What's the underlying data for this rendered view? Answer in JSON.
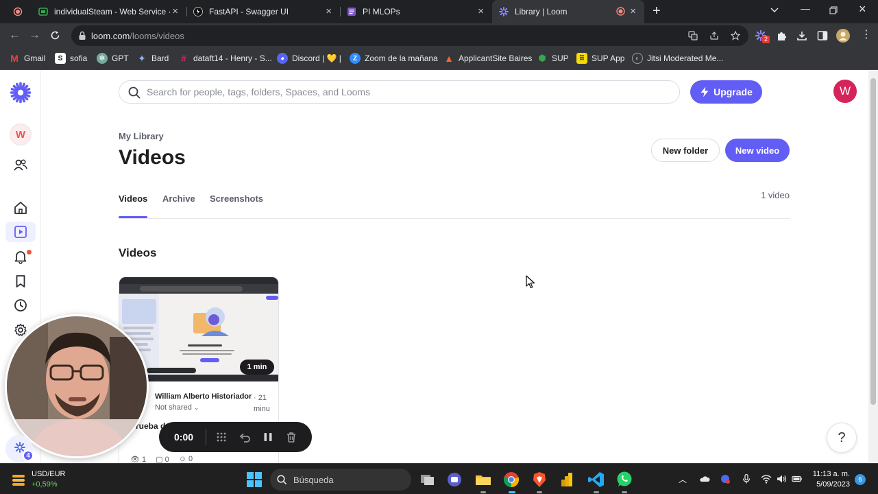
{
  "browser": {
    "tabs": [
      {
        "title": "individualSteam - Web Service ·",
        "icon": "google-cloud-icon",
        "active": false
      },
      {
        "title": "FastAPI - Swagger UI",
        "icon": "swagger-icon",
        "active": false
      },
      {
        "title": "PI MLOPs",
        "icon": "docs-icon",
        "active": false
      },
      {
        "title": "Library | Loom",
        "icon": "loom-icon",
        "active": true
      }
    ],
    "url_host": "loom.com",
    "url_path": "/looms/videos",
    "extension_badge": "2",
    "bookmarks": [
      {
        "label": "Gmail",
        "icon": "gmail-icon",
        "color": "#ea4335"
      },
      {
        "label": "sofia",
        "icon": "sofia-icon",
        "color": "#ffffff"
      },
      {
        "label": "GPT",
        "icon": "openai-icon",
        "color": "#74aa9c"
      },
      {
        "label": "Bard",
        "icon": "bard-icon",
        "color": "#8ab4f8"
      },
      {
        "label": "dataft14 - Henry - S...",
        "icon": "slack-icon",
        "color": "#e01e5a"
      },
      {
        "label": "Discord | 💛 |",
        "icon": "discord-icon",
        "color": "#5865f2"
      },
      {
        "label": "Zoom de la mañana",
        "icon": "zoom-icon",
        "color": "#2d8cff"
      },
      {
        "label": "ApplicantSite Baires",
        "icon": "applicant-icon",
        "color": "#f06a35"
      },
      {
        "label": "SUP",
        "icon": "sup-icon",
        "color": "#34a853"
      },
      {
        "label": "SUP App",
        "icon": "sup-app-icon",
        "color": "#f5d90a"
      },
      {
        "label": "Jitsi Moderated Me...",
        "icon": "jitsi-icon",
        "color": "#9aa0a6"
      }
    ]
  },
  "app": {
    "brand_color": "#625df5",
    "workspace_initial": "W",
    "search_placeholder": "Search for people, tags, folders, Spaces, and Looms",
    "upgrade_label": "Upgrade",
    "user_initial": "W",
    "breadcrumb": "My Library",
    "page_title": "Videos",
    "new_folder_label": "New folder",
    "new_video_label": "New video",
    "tabs": [
      "Videos",
      "Archive",
      "Screenshots"
    ],
    "video_count": "1 video",
    "section_title": "Videos",
    "video_card": {
      "duration": "1 min",
      "owner": "William Alberto Historiador",
      "time": "· 21 minu",
      "share_status": "Not shared",
      "title": "Prueba d",
      "views": "1",
      "comments": "0",
      "reactions": "0"
    },
    "help_label": "?"
  },
  "recording": {
    "timer": "0:00",
    "loom_badge": "4"
  },
  "taskbar": {
    "ticker_name": "USD/EUR",
    "ticker_change": "+0,59%",
    "search_label": "Búsqueda",
    "time": "11:13 a. m.",
    "date": "5/09/2023",
    "notification_count": "6"
  }
}
